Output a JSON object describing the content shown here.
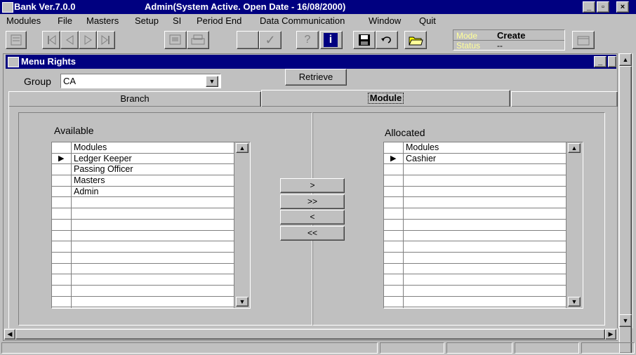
{
  "window": {
    "app_name": "Bank Ver.7.0.0",
    "status_title": "Admin(System Active. Open Date - 16/08/2000)",
    "minimize_label": "_",
    "restore_label": "▫",
    "close_label": "×"
  },
  "menus": [
    "Modules",
    "File",
    "Masters",
    "Setup",
    "SI",
    "Period End",
    "Data Communication",
    "Window",
    "Quit"
  ],
  "toolbar": {
    "mode_label": "Mode",
    "mode_value": "Create",
    "status_label": "Status",
    "status_value": "--",
    "help_glyph": "?",
    "info_glyph": "i",
    "check_glyph": "✓"
  },
  "dialog": {
    "title": "Menu Rights",
    "group_label": "Group",
    "group_value": "CA",
    "retrieve_label": "Retrieve",
    "tabs": [
      "Branch",
      "Module"
    ],
    "active_tab": "Module",
    "available_label": "Available",
    "allocated_label": "Allocated",
    "available_header": "Modules",
    "allocated_header": "Modules",
    "available_items": [
      "Ledger Keeper",
      "Passing Officer",
      "Masters",
      "Admin"
    ],
    "allocated_items": [
      "Cashier"
    ],
    "move_buttons": [
      ">",
      ">>",
      "<",
      "<<"
    ]
  },
  "colors": {
    "titlebar": "#000080",
    "face": "#c0c0c0",
    "yellow_mode": "#ffff99"
  }
}
